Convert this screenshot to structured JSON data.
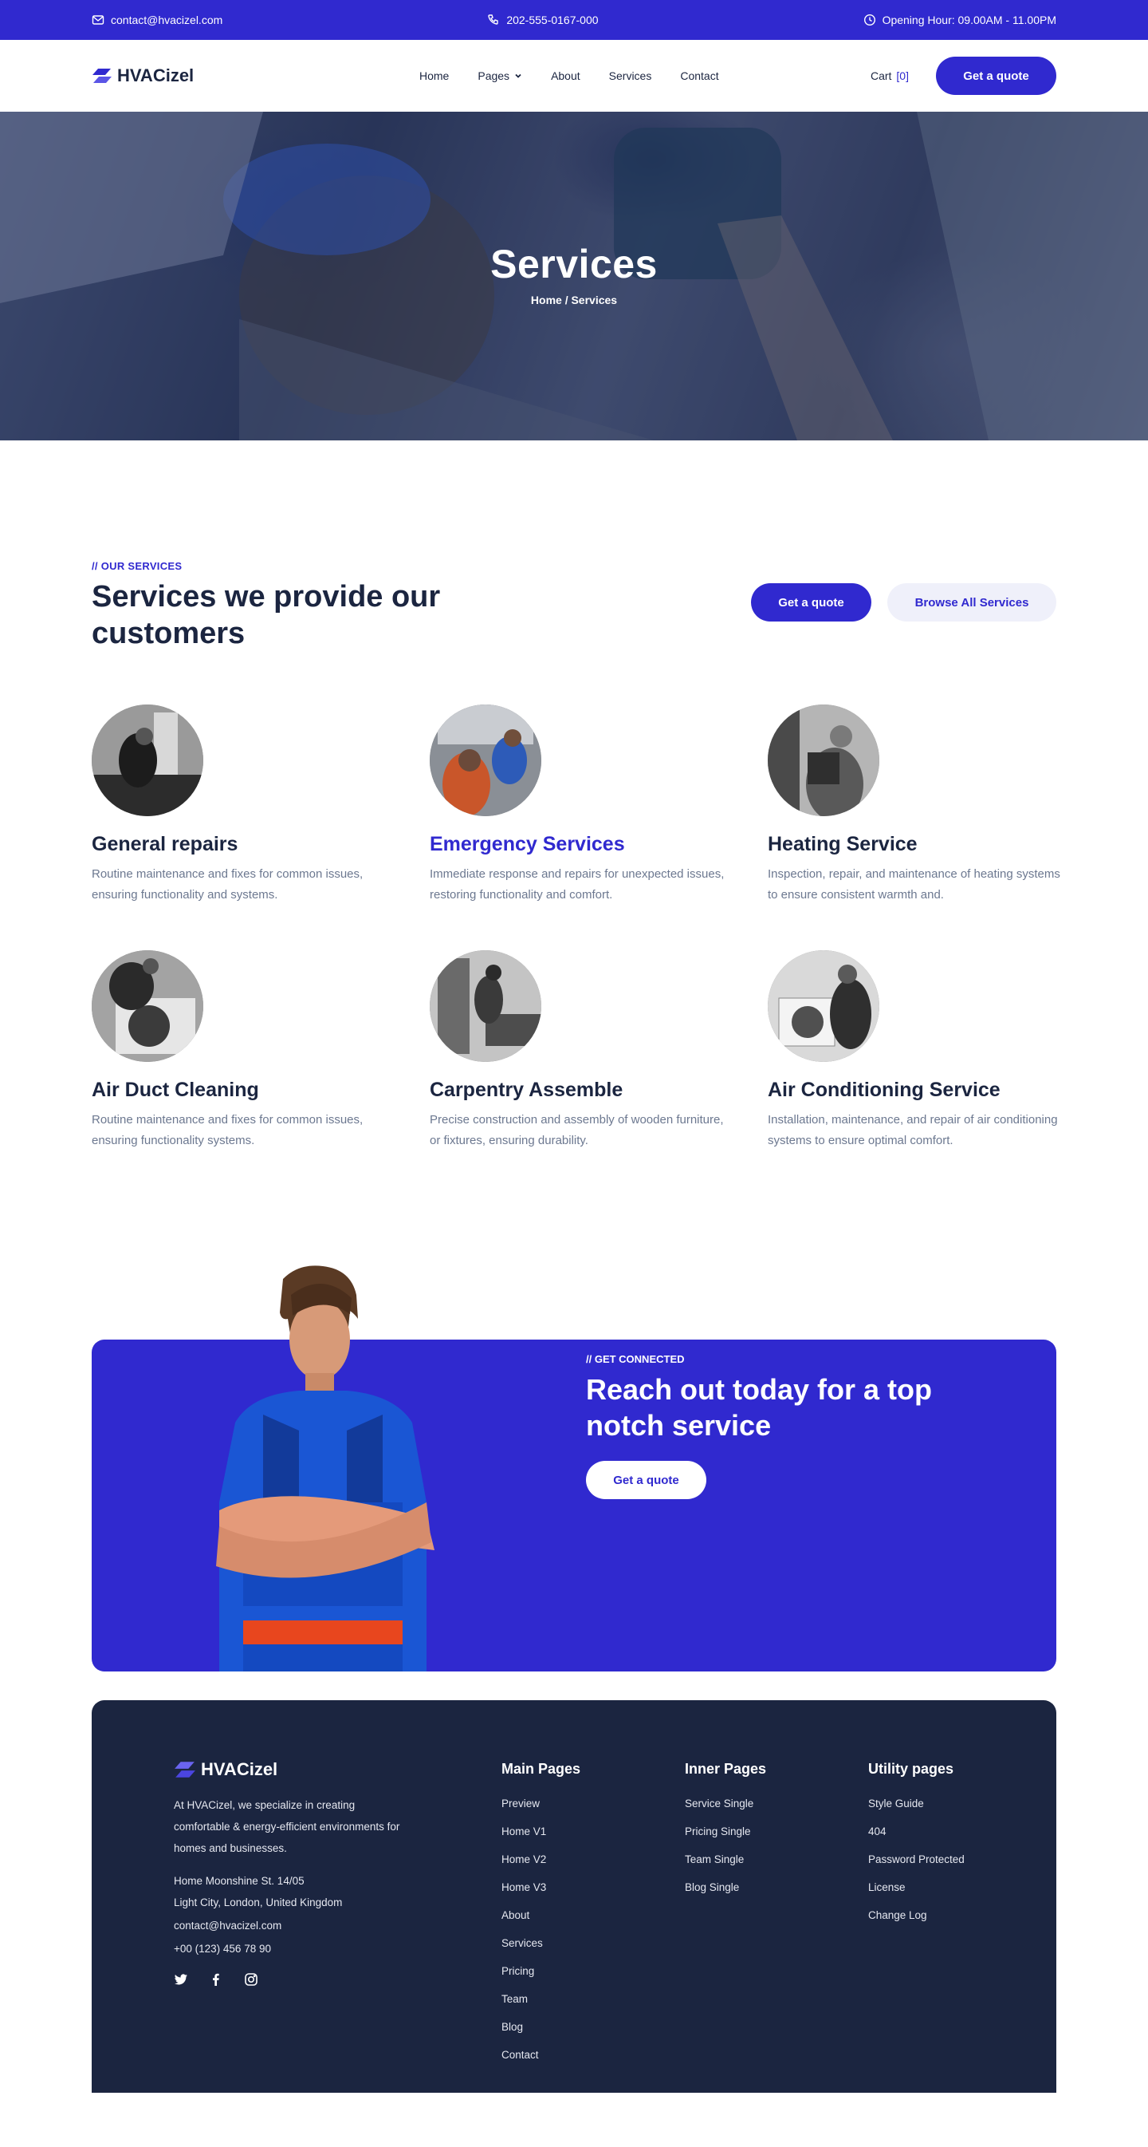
{
  "topbar": {
    "email": "contact@hvacizel.com",
    "phone": "202-555-0167-000",
    "hours": "Opening Hour: 09.00AM - 11.00PM"
  },
  "brand": {
    "name": "HVACizel",
    "accent": "#3029cf",
    "dark": "#1b2540"
  },
  "nav": {
    "items": [
      "Home",
      "Pages",
      "About",
      "Services",
      "Contact"
    ],
    "cart_label": "Cart",
    "cart_count": "[0]",
    "quote_button": "Get a quote"
  },
  "hero": {
    "title": "Services",
    "breadcrumb": "Home / Services"
  },
  "services": {
    "eyebrow": "// OUR SERVICES",
    "title": "Services we provide our customers",
    "primary_button": "Get a quote",
    "secondary_button": "Browse All Services",
    "items": [
      {
        "title": "General repairs",
        "desc": "Routine maintenance and fixes for common issues, ensuring functionality and systems."
      },
      {
        "title": "Emergency Services",
        "desc": "Immediate response and repairs for unexpected issues, restoring functionality and comfort."
      },
      {
        "title": "Heating Service",
        "desc": "Inspection, repair, and maintenance of heating systems to ensure consistent warmth and."
      },
      {
        "title": "Air Duct Cleaning",
        "desc": "Routine maintenance and fixes for common issues, ensuring functionality  systems."
      },
      {
        "title": "Carpentry Assemble",
        "desc": "Precise construction and assembly of wooden furniture, or fixtures, ensuring durability."
      },
      {
        "title": "Air Conditioning Service",
        "desc": "Installation, maintenance, and repair of air conditioning systems to ensure optimal comfort."
      }
    ]
  },
  "cta": {
    "eyebrow": "// GET CONNECTED",
    "title": "Reach out today for a top notch service",
    "button": "Get a quote"
  },
  "footer": {
    "brand": "HVACizel",
    "about": "At HVACizel, we specialize in creating comfortable & energy-efficient environments for homes and businesses.",
    "address_line1": "Home Moonshine St. 14/05",
    "address_line2": "Light City, London, United Kingdom",
    "email": "contact@hvacizel.com",
    "phone": "+00 (123) 456 78 90",
    "main_pages": {
      "title": "Main Pages",
      "links": [
        "Preview",
        "Home V1",
        "Home V2",
        "Home V3",
        "About",
        "Services",
        "Pricing",
        "Team",
        "Blog",
        "Contact"
      ]
    },
    "inner_pages": {
      "title": "Inner Pages",
      "links": [
        "Service Single",
        "Pricing Single",
        "Team Single",
        "Blog Single"
      ]
    },
    "utility_pages": {
      "title": "Utility pages",
      "links": [
        "Style Guide",
        "404",
        "Password Protected",
        "License",
        "Change Log"
      ]
    }
  }
}
